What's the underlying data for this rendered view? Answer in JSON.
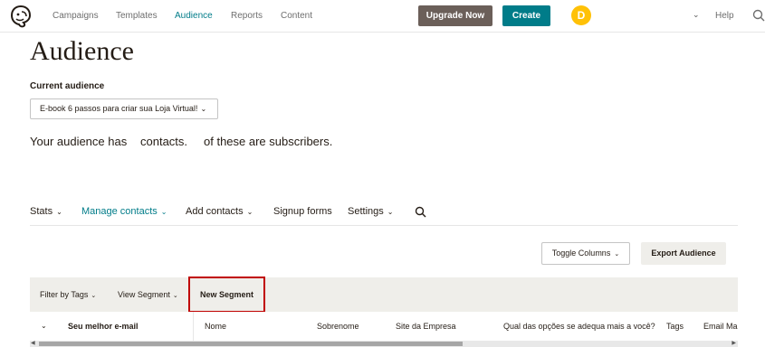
{
  "nav": {
    "links": [
      {
        "label": "Campaigns"
      },
      {
        "label": "Templates"
      },
      {
        "label": "Audience"
      },
      {
        "label": "Reports"
      },
      {
        "label": "Content"
      }
    ],
    "upgrade_label": "Upgrade Now",
    "create_label": "Create",
    "avatar_initial": "D",
    "help_label": "Help",
    "accent_color": "#007c89",
    "avatar_color": "#ffc107"
  },
  "header": {
    "title": "Audience",
    "current_label": "Current audience",
    "audience_name": "E-book 6 passos para criar sua Loja Virtual!",
    "summary": {
      "part1": "Your audience has",
      "part2": "contacts.",
      "part3": "of these are subscribers."
    }
  },
  "subnav": {
    "items": [
      {
        "label": "Stats"
      },
      {
        "label": "Manage contacts"
      },
      {
        "label": "Add contacts"
      },
      {
        "label": "Signup forms"
      },
      {
        "label": "Settings"
      }
    ]
  },
  "toolbar": {
    "toggle_columns_label": "Toggle Columns",
    "export_label": "Export Audience"
  },
  "filters": {
    "filter_by_tags": "Filter by Tags",
    "view_segment": "View Segment",
    "new_segment": "New Segment",
    "highlight_color": "#c00000"
  },
  "table": {
    "columns": [
      "Seu melhor e-mail",
      "Nome",
      "Sobrenome",
      "Site da Empresa",
      "Qual das opções se adequa mais a você?",
      "Tags",
      "Email Mar"
    ]
  }
}
